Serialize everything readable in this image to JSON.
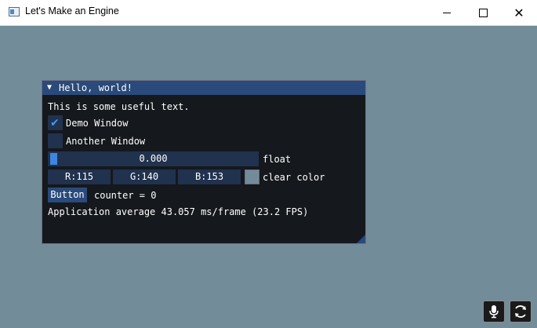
{
  "window": {
    "title": "Let's Make an Engine",
    "icon": "app-window-icon",
    "controls": [
      "minimize",
      "maximize",
      "close"
    ]
  },
  "imgui_window": {
    "title": "Hello, world!",
    "text": "This is some useful text.",
    "checkboxes": [
      {
        "label": "Demo Window",
        "checked": true
      },
      {
        "label": "Another Window",
        "checked": false
      }
    ],
    "slider": {
      "value": "0.000",
      "label": "float"
    },
    "color": {
      "r": "R:115",
      "g": "G:140",
      "b": "B:153",
      "label": "clear color",
      "swatch": "#738c99"
    },
    "button": {
      "label": "Button"
    },
    "counter_text": "counter = 0",
    "stats": "Application average 43.057 ms/frame (23.2 FPS)"
  },
  "tray": [
    "microphone-icon",
    "sync-icon"
  ],
  "colors": {
    "background": "#738c99",
    "imgui_bg": "#15181c",
    "title_active": "#294a7a",
    "frame_bg": "#21324e",
    "accent": "#4296fa"
  }
}
